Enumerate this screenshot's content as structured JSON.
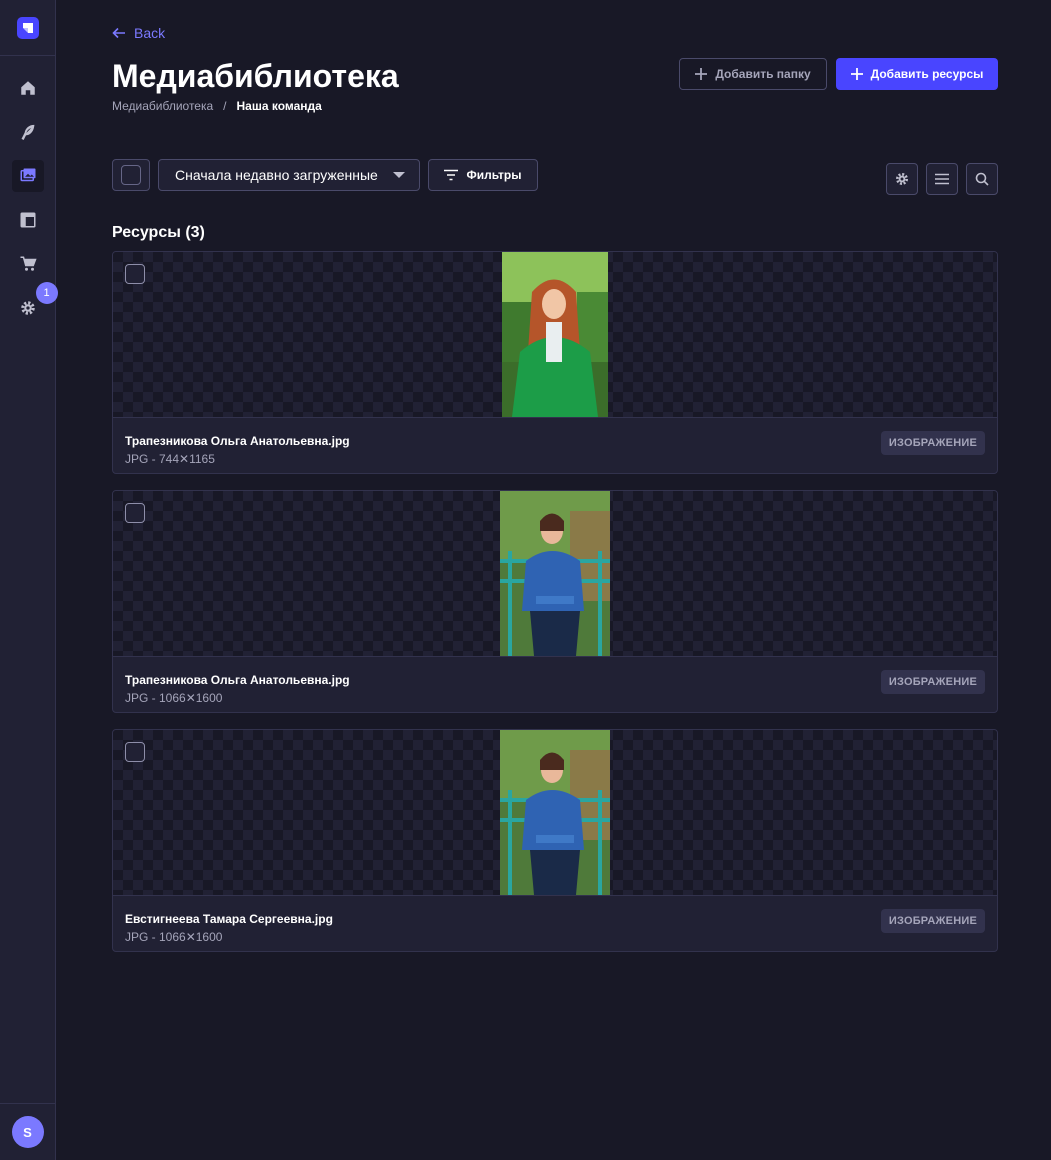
{
  "sidebar": {
    "logo_icon": "strapi-logo-icon",
    "items": [
      {
        "name": "home",
        "icon": "home-icon",
        "active": false
      },
      {
        "name": "content-manager",
        "icon": "feather-icon",
        "active": false
      },
      {
        "name": "media-library",
        "icon": "image-icon",
        "active": true
      },
      {
        "name": "content-type-builder",
        "icon": "layout-icon",
        "active": false
      },
      {
        "name": "marketplace",
        "icon": "cart-icon",
        "active": false
      },
      {
        "name": "settings",
        "icon": "gear-icon",
        "active": false,
        "badge": "1"
      }
    ],
    "avatar_initial": "S"
  },
  "header": {
    "back_label": "Back",
    "title": "Медиабиблиотека",
    "breadcrumb": [
      "Медиабиблиотека",
      "Наша команда"
    ],
    "breadcrumb_separator": "/",
    "add_folder_label": "Добавить папку",
    "add_assets_label": "Добавить ресурсы"
  },
  "toolbar": {
    "sort_selected": "Сначала недавно загруженные",
    "filters_label": "Фильтры"
  },
  "assets_section": {
    "title": "Ресурсы (3)"
  },
  "assets": [
    {
      "name": "Трапезникова Ольга Анатольевна.jpg",
      "info": "JPG - 744✕1165",
      "type": "ИЗОБРАЖЕНИЕ"
    },
    {
      "name": "Трапезникова Ольга Анатольевна.jpg",
      "info": "JPG - 1066✕1600",
      "type": "ИЗОБРАЖЕНИЕ"
    },
    {
      "name": "Евстигнеева Тамара Сергеевна.jpg",
      "info": "JPG - 1066✕1600",
      "type": "ИЗОБРАЖЕНИЕ"
    }
  ],
  "colors": {
    "background": "#181826",
    "surface": "#212134",
    "primary": "#4945ff",
    "accent": "#7b79ff",
    "border": "#32324d"
  }
}
